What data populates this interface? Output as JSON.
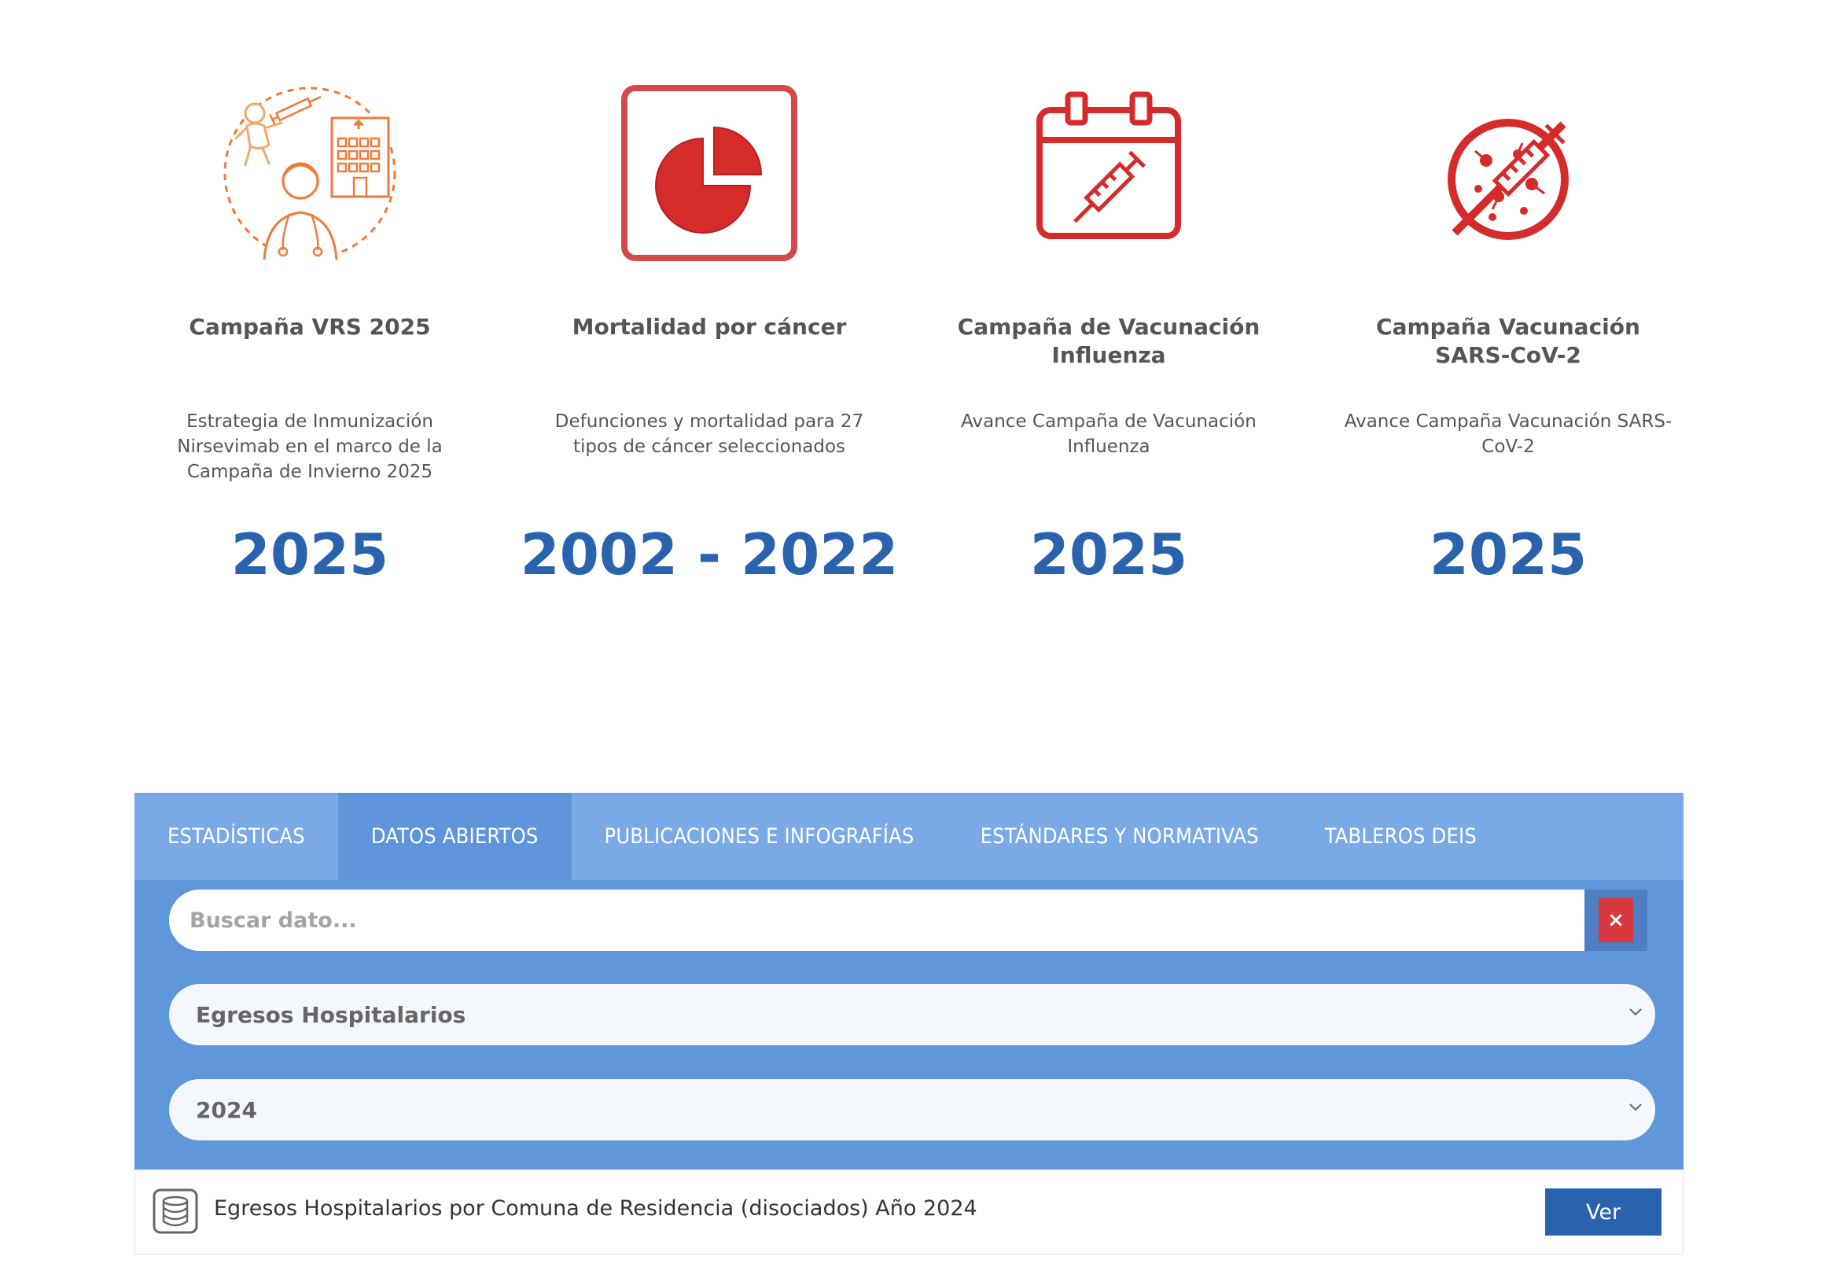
{
  "cards": [
    {
      "icon": "vaccination-campaign-icon",
      "title": "Campaña VRS 2025",
      "description": "Estrategia de Inmunización Nirsevimab en el marco de la Campaña de Invierno 2025",
      "year": "2025"
    },
    {
      "icon": "pie-chart-icon",
      "title": "Mortalidad por cáncer",
      "description": "Defunciones y mortalidad para 27 tipos de cáncer seleccionados",
      "year": "2002 - 2022"
    },
    {
      "icon": "calendar-syringe-icon",
      "title": "Campaña de Vacunación Influenza",
      "description": "Avance Campaña de Vacunación Influenza",
      "year": "2025"
    },
    {
      "icon": "virus-syringe-icon",
      "title": "Campaña Vacunación SARS-CoV-2",
      "description": "Avance Campaña Vacunación SARS-CoV-2",
      "year": "2025"
    }
  ],
  "tabs": [
    {
      "label": "ESTADÍSTICAS",
      "active": false
    },
    {
      "label": "DATOS ABIERTOS",
      "active": true
    },
    {
      "label": "PUBLICACIONES E INFOGRAFÍAS",
      "active": false
    },
    {
      "label": "ESTÁNDARES Y NORMATIVAS",
      "active": false
    },
    {
      "label": "TABLEROS DEIS",
      "active": false
    }
  ],
  "search": {
    "placeholder": "Buscar dato...",
    "value": "",
    "clear_label": "×"
  },
  "filters": {
    "dataset": "Egresos Hospitalarios",
    "year": "2024"
  },
  "result": {
    "icon": "database-icon",
    "text": "Egresos Hospitalarios por Comuna de Residencia (disociados) Año 2024",
    "button_label": "Ver"
  },
  "colors": {
    "accent": "#2a63ad",
    "tab_bar": "#7aaae5",
    "tab_active": "#5f95da",
    "filter_bg": "#6097db",
    "icon_red": "#d52b2b",
    "icon_orange": "#f07a3a"
  }
}
